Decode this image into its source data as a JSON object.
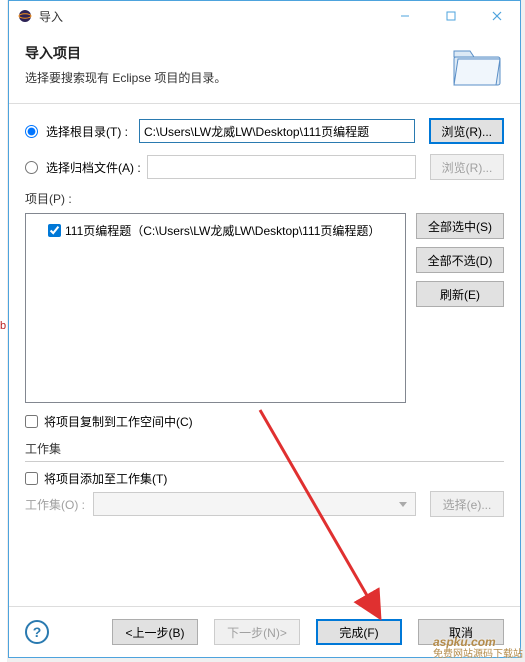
{
  "titlebar": {
    "title": "导入"
  },
  "header": {
    "title": "导入项目",
    "desc": "选择要搜索现有 Eclipse 项目的目录。"
  },
  "root": {
    "radio_root_label": "选择根目录(T) :",
    "root_path": "C:\\Users\\LW龙威LW\\Desktop\\111页编程题",
    "browse_root": "浏览(R)...",
    "radio_archive_label": "选择归档文件(A) :",
    "archive_path": "",
    "browse_archive": "浏览(R)..."
  },
  "projects": {
    "label": "项目(P) :",
    "items": [
      {
        "checked": true,
        "label": "111页编程题（C:\\Users\\LW龙威LW\\Desktop\\111页编程题）"
      }
    ],
    "select_all": "全部选中(S)",
    "deselect_all": "全部不选(D)",
    "refresh": "刷新(E)"
  },
  "copy_checkbox": "将项目复制到工作空间中(C)",
  "workingset": {
    "group_title": "工作集",
    "add_checkbox": "将项目添加至工作集(T)",
    "label": "工作集(O) :",
    "select_btn": "选择(e)..."
  },
  "footer": {
    "back": "<上一步(B)",
    "next": "下一步(N)>",
    "finish": "完成(F)",
    "cancel": "取消"
  },
  "watermark": {
    "main": "aspku",
    "domain": ".com",
    "sub": "免费网站源码下载站"
  }
}
